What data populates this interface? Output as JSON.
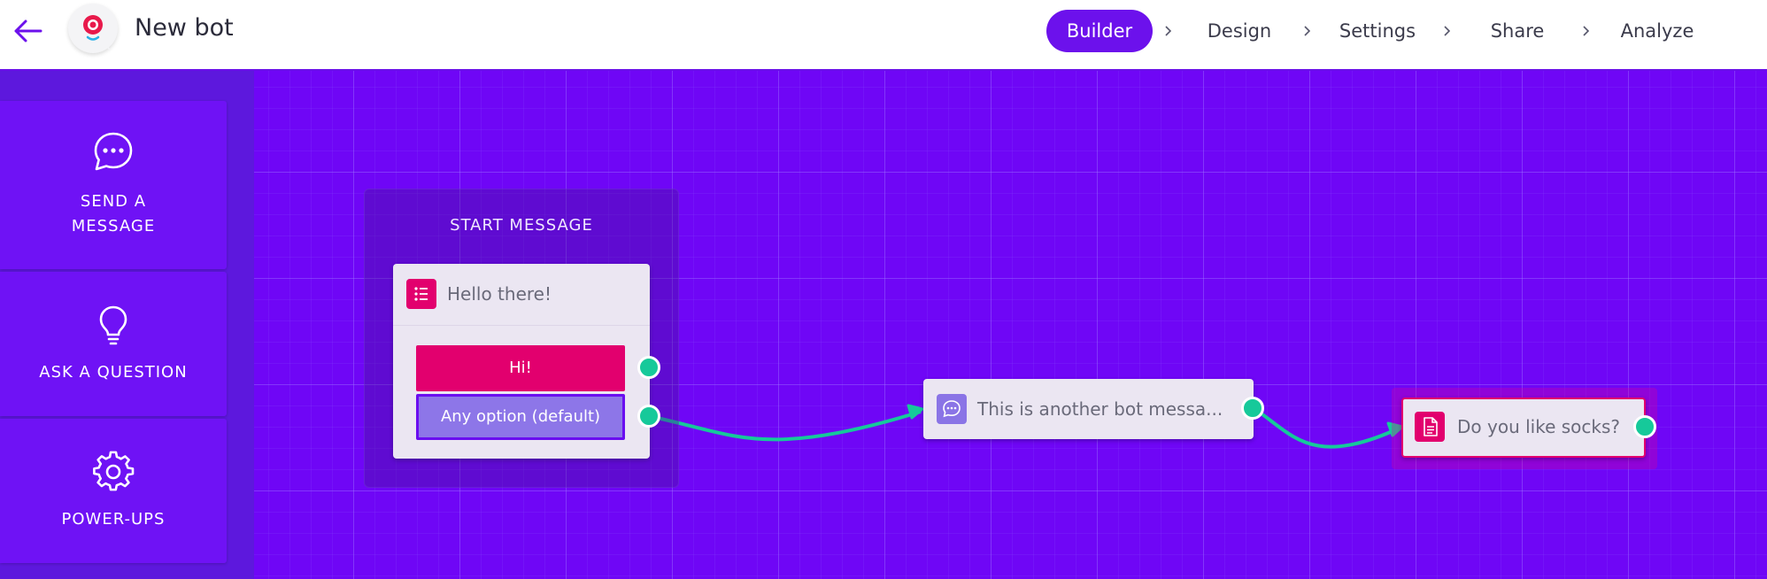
{
  "header": {
    "bot_name": "New bot",
    "steps": [
      {
        "label": "Builder",
        "active": true
      },
      {
        "label": "Design",
        "active": false
      },
      {
        "label": "Settings",
        "active": false
      },
      {
        "label": "Share",
        "active": false
      },
      {
        "label": "Analyze",
        "active": false
      }
    ]
  },
  "sidebar": {
    "tools": [
      {
        "label_line1": "SEND A",
        "label_line2": "MESSAGE",
        "icon": "chat-bubble-icon"
      },
      {
        "label": "ASK A QUESTION",
        "icon": "lightbulb-icon"
      },
      {
        "label": "POWER-UPS",
        "icon": "gear-icon"
      }
    ]
  },
  "canvas": {
    "start_group_title": "START MESSAGE",
    "start_card": {
      "text": "Hello there!",
      "icon": "list-icon",
      "options": [
        "Hi!",
        "Any option (default)"
      ]
    },
    "bot_message_card": {
      "text": "This is another bot messa...",
      "icon": "chat-bubble-icon"
    },
    "question_card": {
      "text": "Do you like socks?",
      "icon": "document-icon"
    }
  },
  "colors": {
    "accent": "#6c11ec",
    "canvas": "#6f06f6",
    "pink": "#e2006e",
    "connector": "#16c99a"
  }
}
